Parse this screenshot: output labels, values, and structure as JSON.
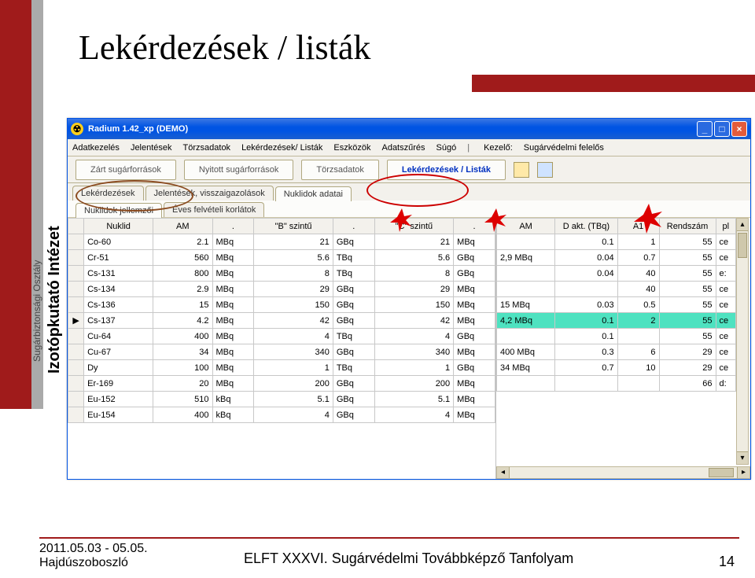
{
  "slide": {
    "title": "Lekérdezések / listák",
    "side_institute": "Izotópkutató Intézet",
    "side_dept": "Sugárbiztonsági Osztály"
  },
  "window": {
    "title": "Radium 1.42_xp     (DEMO)",
    "menus": [
      "Adatkezelés",
      "Jelentések",
      "Törzsadatok",
      "Lekérdezések/ Listák",
      "Eszközök",
      "Adatszűrés",
      "Súgó"
    ],
    "handler_label": "Kezelő:",
    "handler_value": "Sugárvédelmi felelős",
    "bigtabs": [
      "Zárt sugárforrások",
      "Nyitott sugárforrások",
      "Törzsadatok",
      "Lekérdezések / Listák"
    ],
    "subtabs1": [
      "Lekérdezések",
      "Jelentések, visszaigazolások",
      "Nuklidok adatai"
    ],
    "subtabs2": [
      "Nuklidok jellemzői",
      "Éves felvételi korlátok"
    ]
  },
  "left_headers": [
    "",
    "Nuklid",
    "AM",
    ".",
    "\"B\" szintű",
    ".",
    "\"C\" szintű",
    "."
  ],
  "left_rows": [
    {
      "mark": "",
      "n": "Co-60",
      "am": "2.1",
      "amu": "MBq",
      "b": "21",
      "bu": "GBq",
      "c": "21",
      "cu": "MBq"
    },
    {
      "mark": "",
      "n": "Cr-51",
      "am": "560",
      "amu": "MBq",
      "b": "5.6",
      "bu": "TBq",
      "c": "5.6",
      "cu": "GBq"
    },
    {
      "mark": "",
      "n": "Cs-131",
      "am": "800",
      "amu": "MBq",
      "b": "8",
      "bu": "TBq",
      "c": "8",
      "cu": "GBq"
    },
    {
      "mark": "",
      "n": "Cs-134",
      "am": "2.9",
      "amu": "MBq",
      "b": "29",
      "bu": "GBq",
      "c": "29",
      "cu": "MBq"
    },
    {
      "mark": "",
      "n": "Cs-136",
      "am": "15",
      "amu": "MBq",
      "b": "150",
      "bu": "GBq",
      "c": "150",
      "cu": "MBq"
    },
    {
      "mark": "▶",
      "n": "Cs-137",
      "am": "4.2",
      "amu": "MBq",
      "b": "42",
      "bu": "GBq",
      "c": "42",
      "cu": "MBq"
    },
    {
      "mark": "",
      "n": "Cu-64",
      "am": "400",
      "amu": "MBq",
      "b": "4",
      "bu": "TBq",
      "c": "4",
      "cu": "GBq"
    },
    {
      "mark": "",
      "n": "Cu-67",
      "am": "34",
      "amu": "MBq",
      "b": "340",
      "bu": "GBq",
      "c": "340",
      "cu": "MBq"
    },
    {
      "mark": "",
      "n": "Dy",
      "am": "100",
      "amu": "MBq",
      "b": "1",
      "bu": "TBq",
      "c": "1",
      "cu": "GBq"
    },
    {
      "mark": "",
      "n": "Er-169",
      "am": "20",
      "amu": "MBq",
      "b": "200",
      "bu": "GBq",
      "c": "200",
      "cu": "MBq"
    },
    {
      "mark": "",
      "n": "Eu-152",
      "am": "510",
      "amu": "kBq",
      "b": "5.1",
      "bu": "GBq",
      "c": "5.1",
      "cu": "MBq"
    },
    {
      "mark": "",
      "n": "Eu-154",
      "am": "400",
      "amu": "kBq",
      "b": "4",
      "bu": "GBq",
      "c": "4",
      "cu": "MBq"
    }
  ],
  "right_headers": [
    "AM",
    "D akt. (TBq)",
    "A1",
    "Rendszám",
    "pl"
  ],
  "right_rows": [
    {
      "am": "",
      "d": "0.1",
      "a1": "1",
      "r": "55",
      "x": "ce",
      "hl": false
    },
    {
      "am": "2,9 MBq",
      "d": "0.04",
      "a1": "0.7",
      "r": "55",
      "x": "ce",
      "hl": false
    },
    {
      "am": "",
      "d": "0.04",
      "a1": "40",
      "r": "55",
      "x": "e:",
      "hl": false
    },
    {
      "am": "",
      "d": "",
      "a1": "40",
      "r": "55",
      "x": "ce",
      "hl": false
    },
    {
      "am": "15 MBq",
      "d": "0.03",
      "a1": "0.5",
      "r": "55",
      "x": "ce",
      "hl": false
    },
    {
      "am": "4,2 MBq",
      "d": "0.1",
      "a1": "2",
      "r": "55",
      "x": "ce",
      "hl": true
    },
    {
      "am": "",
      "d": "0.1",
      "a1": "",
      "r": "55",
      "x": "ce",
      "hl": false
    },
    {
      "am": "400 MBq",
      "d": "0.3",
      "a1": "6",
      "r": "29",
      "x": "ce",
      "hl": false
    },
    {
      "am": "34 MBq",
      "d": "0.7",
      "a1": "10",
      "r": "29",
      "x": "ce",
      "hl": false
    },
    {
      "am": "",
      "d": "",
      "a1": "",
      "r": "66",
      "x": "d:",
      "hl": false
    }
  ],
  "footer": {
    "date": "2011.05.03 - 05.05.",
    "place": "Hajdúszoboszló",
    "mid": "ELFT XXXVI. Sugárvédelmi Továbbképző Tanfolyam",
    "page": "14"
  }
}
